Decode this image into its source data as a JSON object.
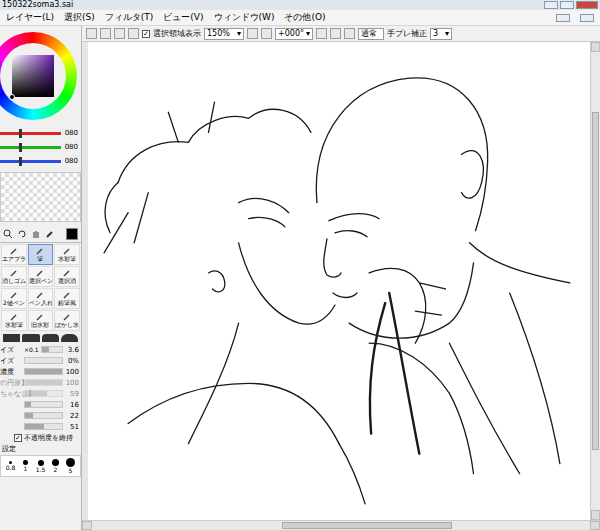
{
  "window": {
    "title": "150322soma3.sai"
  },
  "menu": [
    "レイヤー(L)",
    "選択(S)",
    "フィルタ(T)",
    "ビュー(V)",
    "ウィンドウ(W)",
    "その他(O)"
  ],
  "toolbar": {
    "show_selection": {
      "label": "選択領域表示",
      "checked": true
    },
    "zoom": "150%",
    "angle": "+000°",
    "blend": "通常",
    "stabilizer": {
      "label": "手ブレ補正",
      "value": "3"
    }
  },
  "color": {
    "current": "#000000",
    "wheel_hue": "#6a1fb0",
    "sliders": [
      {
        "value": "080",
        "level": 0.31,
        "color": "#e02424"
      },
      {
        "value": "080",
        "level": 0.31,
        "color": "#22b022"
      },
      {
        "value": "080",
        "level": 0.31,
        "color": "#2a4ee0"
      }
    ]
  },
  "tools": [
    {
      "label": "エアブラ",
      "selected": false
    },
    {
      "label": "筆",
      "selected": true
    },
    {
      "label": "水彩筆",
      "selected": false
    },
    {
      "label": "消しゴム",
      "selected": false
    },
    {
      "label": "選択ペン",
      "selected": false
    },
    {
      "label": "選択消",
      "selected": false
    },
    {
      "label": "2値ペン",
      "selected": false
    },
    {
      "label": "ペン入れ",
      "selected": false
    },
    {
      "label": "鉛筆風",
      "selected": false
    },
    {
      "label": "水彩筆",
      "selected": false
    },
    {
      "label": "旧水彩",
      "selected": false
    },
    {
      "label": "ぼかし水",
      "selected": false
    }
  ],
  "brush_settings": [
    {
      "label": "イズ",
      "prefix": "×0.1",
      "value": "3.6",
      "level": 0.35,
      "disabled": false
    },
    {
      "label": "イズ",
      "prefix": "",
      "value": "0%",
      "level": 0,
      "disabled": false
    },
    {
      "label": "濃度",
      "prefix": "",
      "value": "100",
      "level": 1,
      "disabled": false
    },
    {
      "label": "の円形】",
      "prefix": "",
      "value": "100",
      "level": 1,
      "disabled": true
    },
    {
      "label": "ちゃなし】",
      "prefix": "",
      "value": "59",
      "level": 0.59,
      "disabled": true
    },
    {
      "label": "",
      "prefix": "",
      "value": "16",
      "level": 0.16,
      "disabled": false
    },
    {
      "label": "",
      "prefix": "",
      "value": "22",
      "level": 0.22,
      "disabled": false
    },
    {
      "label": "",
      "prefix": "",
      "value": "51",
      "level": 0.51,
      "disabled": false
    }
  ],
  "keep_opacity": {
    "label": "不透明度を維持",
    "checked": true
  },
  "size_header": "設定",
  "sizes": [
    "0.8",
    "1",
    "1.5",
    "2",
    "5"
  ]
}
